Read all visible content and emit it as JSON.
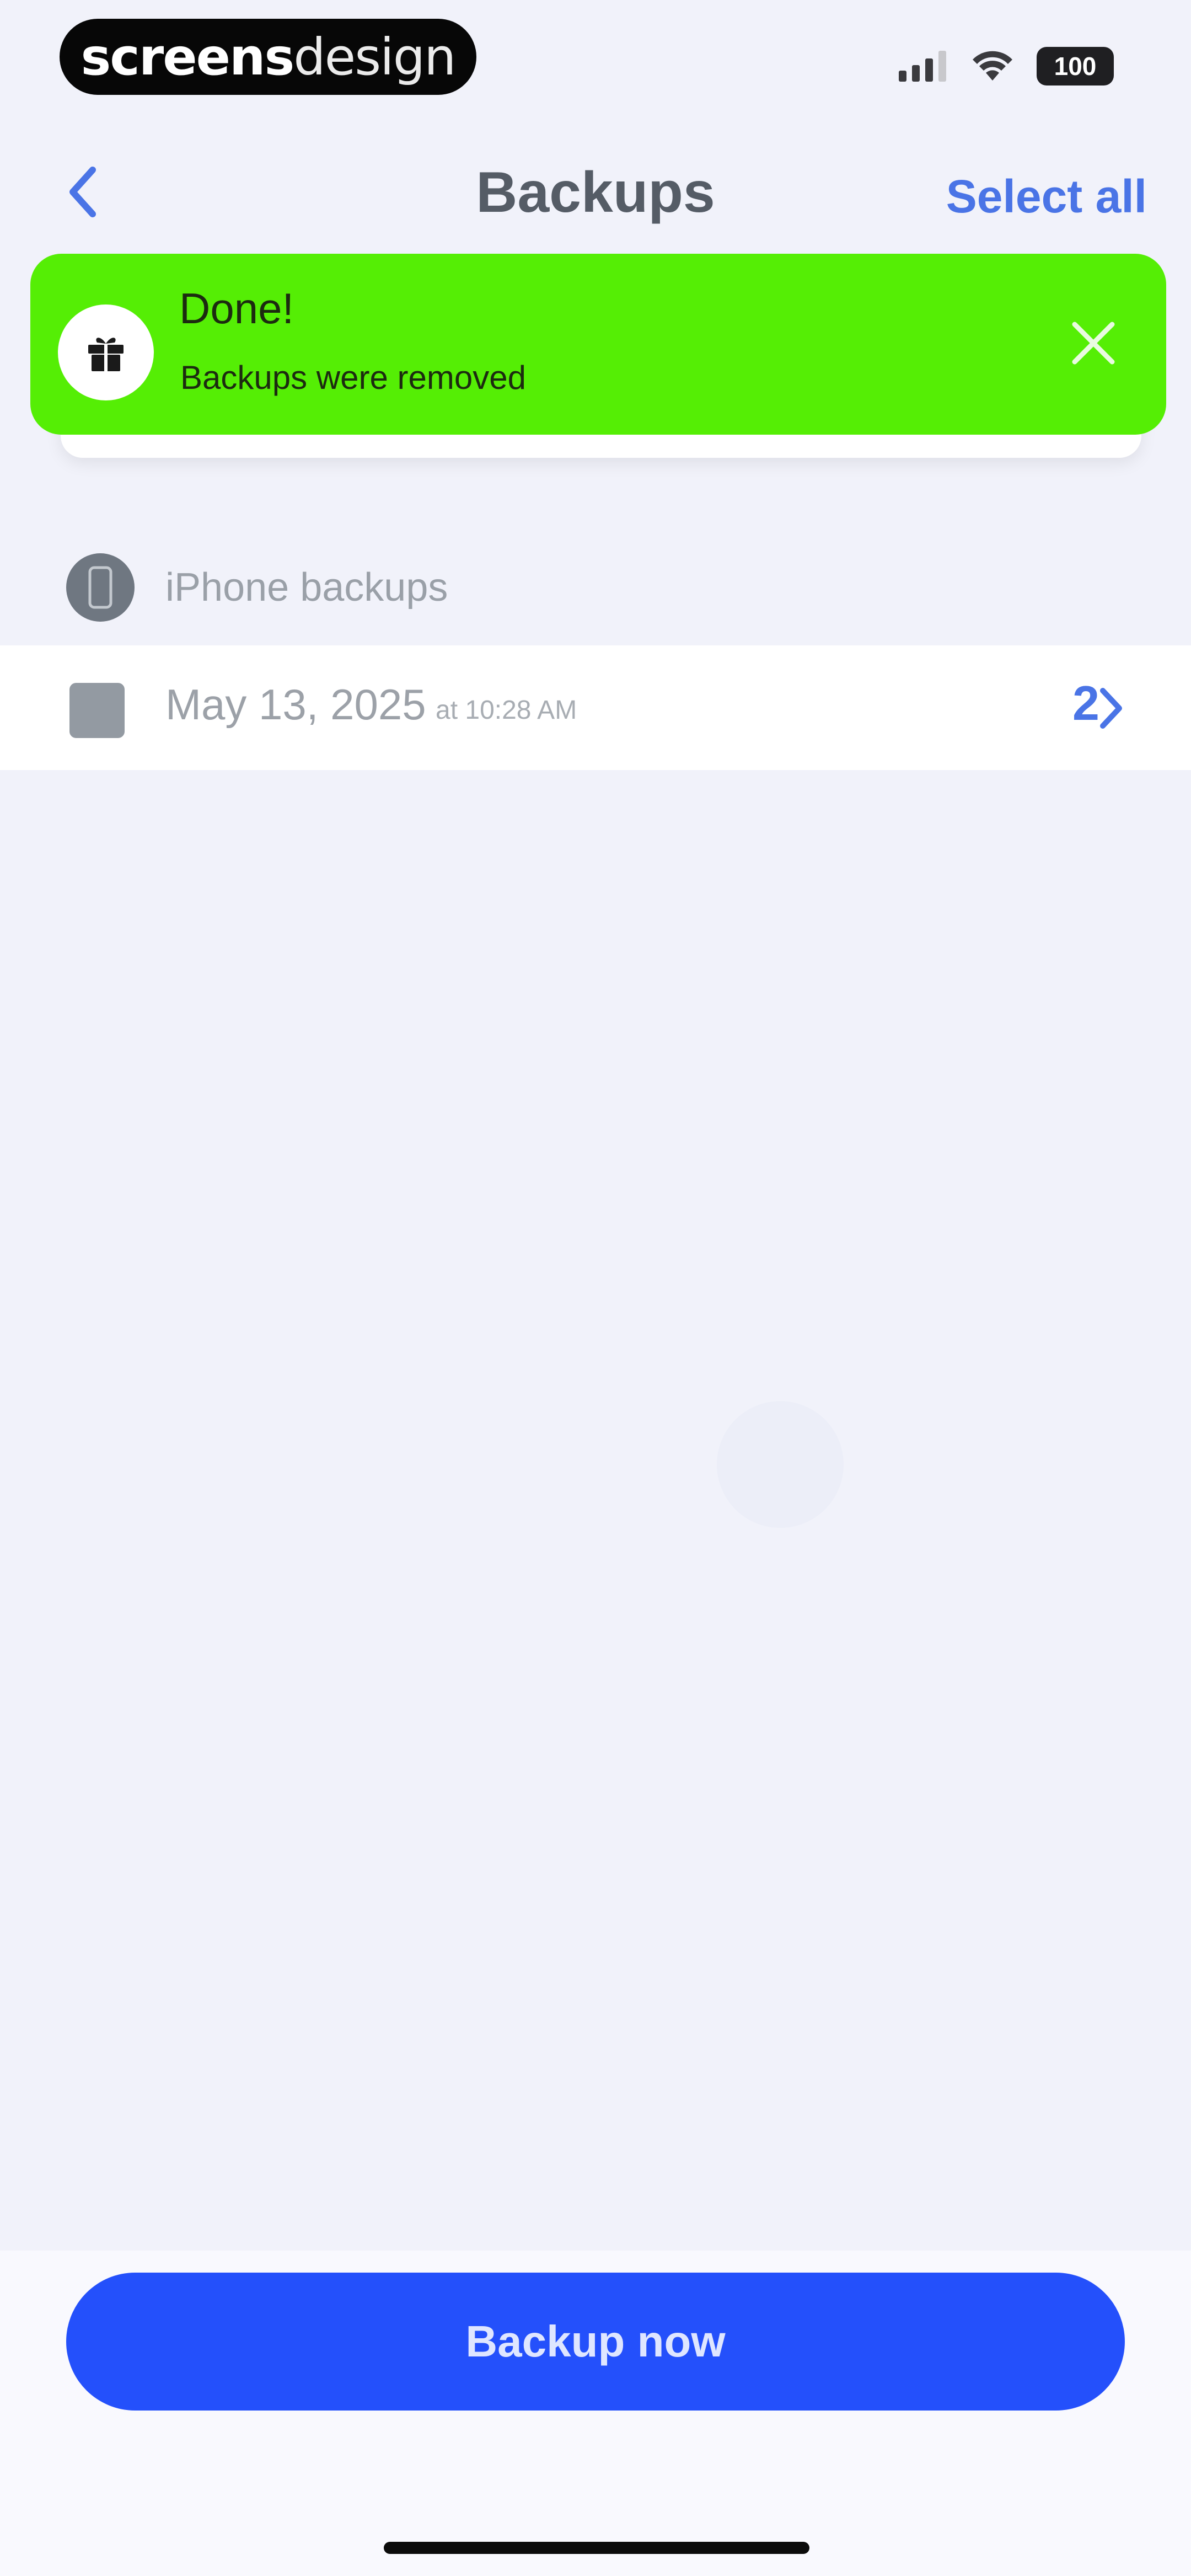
{
  "status_bar": {
    "watermark_bold": "screens",
    "watermark_light": "design",
    "battery": "100"
  },
  "nav": {
    "title": "Backups",
    "select_all_label": "Select all"
  },
  "toast": {
    "title": "Done!",
    "message": "Backups were removed",
    "color": "#55ee05"
  },
  "section": {
    "title": "iPhone backups"
  },
  "backup_rows": [
    {
      "date": "May 13, 2025",
      "time": "at 10:28 AM",
      "count": "2"
    }
  ],
  "bottom": {
    "backup_button_label": "Backup now",
    "accent_color": "#2450fb"
  }
}
